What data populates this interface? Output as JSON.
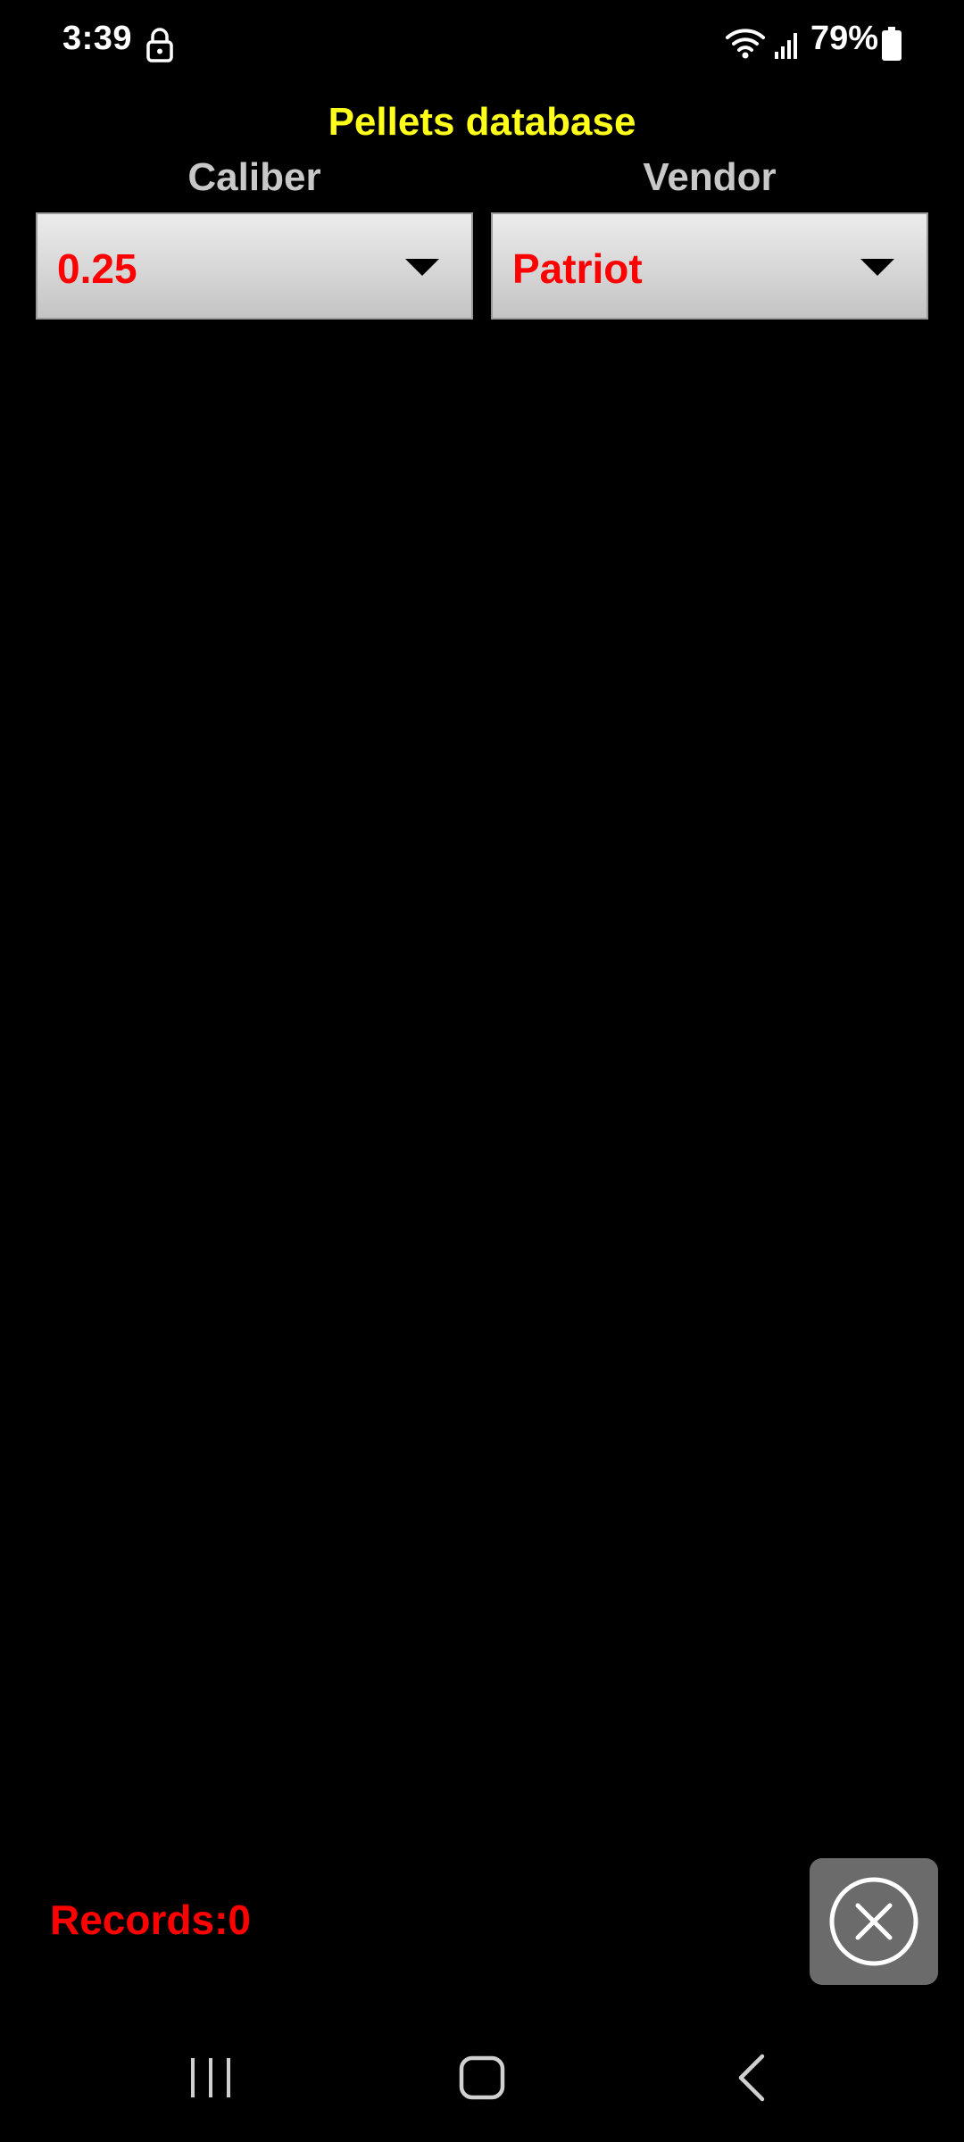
{
  "status_bar": {
    "time": "3:39",
    "battery_percent": "79%",
    "icons": [
      "lock-icon",
      "wifi-icon",
      "signal-icon",
      "battery-icon"
    ]
  },
  "header": {
    "title": "Pellets database"
  },
  "filters": {
    "caliber": {
      "label": "Caliber",
      "value": "0.25"
    },
    "vendor": {
      "label": "Vendor",
      "value": "Patriot"
    }
  },
  "footer": {
    "records_text": "Records:0"
  },
  "nav_bar": {
    "icons": [
      "recents-icon",
      "home-icon",
      "back-icon"
    ]
  },
  "colors": {
    "background": "#000000",
    "title": "#ffff1a",
    "label": "#c8c8c8",
    "value": "#ff0000",
    "close_button_bg": "#6b6b6b"
  }
}
